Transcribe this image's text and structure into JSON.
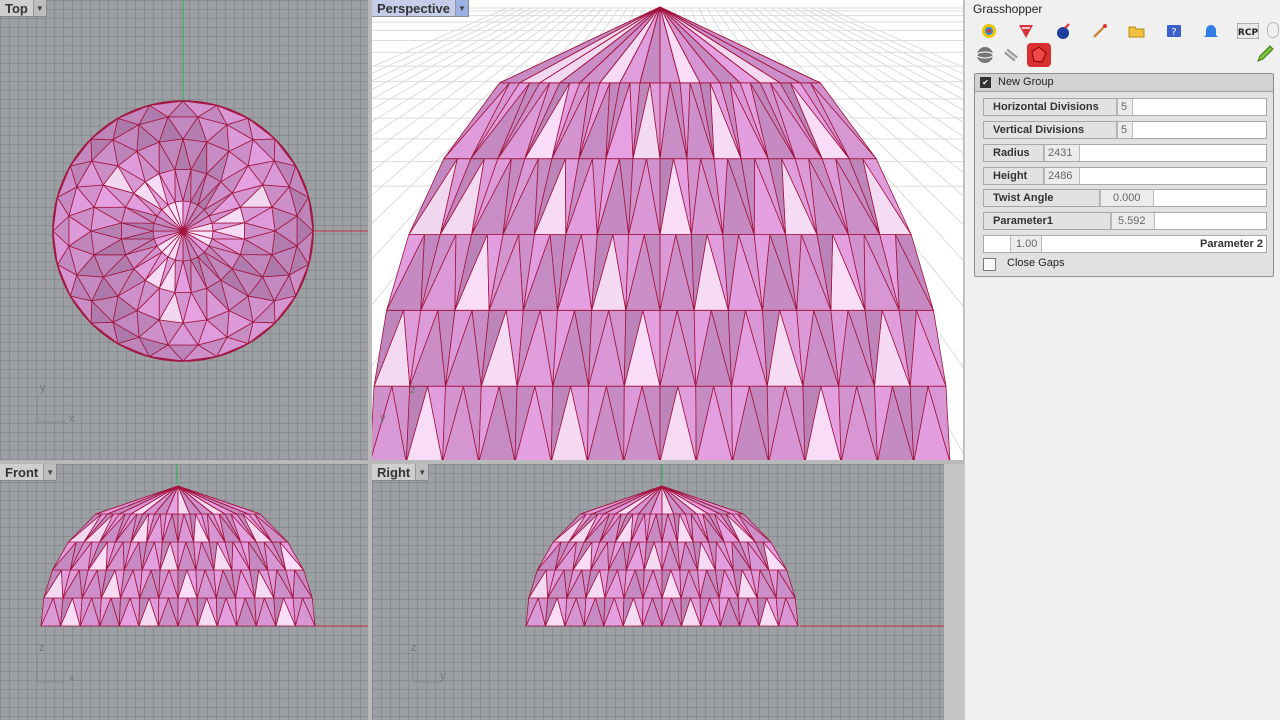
{
  "viewports": {
    "top": {
      "label": "Top"
    },
    "perspective": {
      "label": "Perspective"
    },
    "front": {
      "label": "Front"
    },
    "right": {
      "label": "Right"
    }
  },
  "axes": {
    "x": "x",
    "y": "y",
    "z": "z"
  },
  "grasshopper": {
    "title": "Grasshopper",
    "toolbar_icons": [
      "params-icon",
      "maths-icon",
      "vector-icon",
      "curve-icon",
      "open-icon",
      "help-icon",
      "notification-icon",
      "rcp-icon"
    ],
    "rcp_label": "RCP",
    "group": {
      "title": "New Group",
      "sliders": [
        {
          "name": "Horizontal Divisions",
          "value": "5"
        },
        {
          "name": "Vertical Divisions",
          "value": "5"
        },
        {
          "name": "Radius",
          "value": "2431"
        },
        {
          "name": "Height",
          "value": "2486"
        },
        {
          "name": "Twist Angle",
          "value": "0.000"
        },
        {
          "name": "Parameter1",
          "value": "5.592"
        },
        {
          "name": "Parameter 2",
          "value": "1.00"
        }
      ],
      "close_gaps_label": "Close Gaps"
    }
  },
  "colors": {
    "dome_fill": "#f0a8ec",
    "dome_edge": "#a2153f",
    "active_tab": "#c6cdea"
  }
}
